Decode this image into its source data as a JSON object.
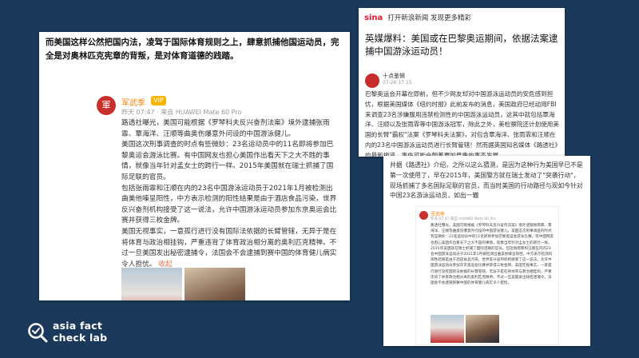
{
  "card1": {
    "header": "而美国这样公然把国内法，凌驾于国际体育规则之上，肆意抓捕他国运动员，完全是对奥林匹克宪章的背叛，是对体育道德的践踏。",
    "user": "军武季",
    "meta": "昨天 07:47 · 来自 HUAWEI Mate 60 Pro",
    "paragraphs": [
      "路透社曝光，美国可能根据《罗琴科夫反兴奋剂法案》境外逮捕张雨霏、覃海洋、汪顺等曲奥伤爆意外问设的中国游泳健儿。",
      "美国这次刑事调查的时点有些微妙：23名运动员中的11名即将参加巴黎奥运会游泳比赛。有中国网友也担心美国作出看天下之大不韪的事情，就像当年针对孟女士的跨行一样。2015年美国就在瑞士抓捕了国际足联的官员。",
      "包括张雨霏和汪顺在内的23名中国游泳运动员于2021年1月被检测出曲美他嗪呈阳性，中方表示检测的阳性结果是由于酒店食品污染，世界反兴奋剂机构接受了这一说法，允许中国游泳运动员参加东京奥运会比赛并获得三枚金牌。",
      "美国无视事实，一意孤行进行没有国际法依据的长臂管辖，无异于是在将体育与政治相挂钩，严重违背了体育政治相分离的奥利匹克精神。不过一旦美国发出秘密逮捕令，法国会不会逮捕到赛中国的体育健儿病实令人担忧。"
    ],
    "more": "收起"
  },
  "card2": {
    "brand": "sina",
    "topbar": "打开新浪新闻  发现更多精彩",
    "title": "英媒爆料：美国或在巴黎奥运期间，依据法案逮捕中国游泳运动员！",
    "author": "十点鉴辑",
    "time": "07-26 17:15",
    "body": "巴黎奥运会开幕在即前，但不少网友却对中国游泳运动员的安危感到担忧，根据美国媒体《纽约时报》此前发布的消息，美国政府已经动用FBI来调查23名涉嫌服用违禁检测性的中国游泳运动员，这其中就包括覃海洋、汪顺以及张雨霏等中国游泳冠军，除此之外，美检察院还计划使用美国的长臂\"霸权\"法案《罗琴科夫法案》，对包含覃海洋、张雨霏和汪顺在内的23名中国游泳运动员进行长臂管辖！然而据英国知名媒体《路透社》的最新报道，事件可能会朝着更加严重的事态发展"
  },
  "card3": {
    "body": "并据《路透社》介绍，之所以这么猜测，是因为这种行为美国早已不是第一次使用了，早在2015年，美国警方就在瑞士发动了\"突袭行动\"，现场抓捕了多名国际足联的官员，而当时美国的行动路径与现如今针对中国23名游泳运动员，如出一辙",
    "inner_user": "军武季",
    "inner_meta": "昨天 07:47 来自 HUAWEI Mate 60 Pro",
    "inner_body": "路透社曝光，美国可能根据《罗琴科夫反兴奋剂法案》境外逮捕张雨霏、覃海洋、汪顺等曲奥伤爆意外问设的中国游泳健儿。美国这次刑事调查的时点有些微妙：23名运动员中的11名即将参加巴黎奥运会游泳比赛。有中国网友也担心美国作出看天下之大不韪的事情，就像当年针对孟女士的跨行一样。2015年美国就在瑞士抓捕了国际足联的官员。包括张雨霏和汪顺在内的23名中国游泳运动员于2021年1月被检测出曲美他嗪呈阳性，中方表示检测的阳性结果是由于酒店食品污染，世界反兴奋剂机构接受了这一说法，允许中国游泳运动员参加东京奥运会比赛并获得三枚金牌。美国无视事实，一意孤行进行没有国际法依据的长臂管辖，无异于是在将体育与政治相挂钩，严重违背了体育政治相分离的奥利匹克精神。不过一旦美国发出秘密逮捕令，法国会不会逮捕到赛中国的体育健儿病实令人担忧。"
  },
  "logo": {
    "line1": "asia fact",
    "line2": "check lab"
  }
}
